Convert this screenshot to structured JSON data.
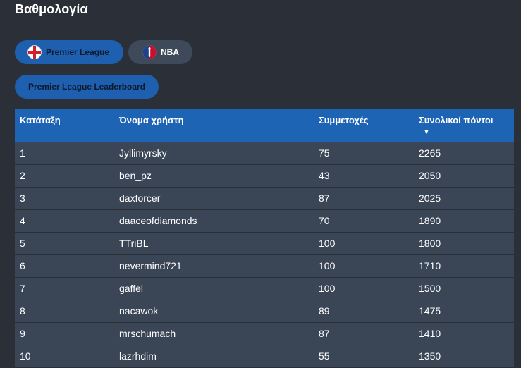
{
  "title": "Βαθμολογία",
  "tabs": [
    {
      "label": "Premier League",
      "icon": "england-flag-icon",
      "active": true
    },
    {
      "label": "NBA",
      "icon": "nba-logo-icon",
      "active": false
    }
  ],
  "leaderboard_button": "Premier League Leaderboard",
  "table": {
    "headers": [
      "Κατάταξη",
      "Όνομα χρήστη",
      "Συμμετοχές",
      "Συνολικοί πόντοι"
    ],
    "sort_indicator": "▼",
    "rows": [
      {
        "rank": "1",
        "user": "Jyllimyrsky",
        "entries": "75",
        "points": "2265"
      },
      {
        "rank": "2",
        "user": "ben_pz",
        "entries": "43",
        "points": "2050"
      },
      {
        "rank": "3",
        "user": "daxforcer",
        "entries": "87",
        "points": "2025"
      },
      {
        "rank": "4",
        "user": "daaceofdiamonds",
        "entries": "70",
        "points": "1890"
      },
      {
        "rank": "5",
        "user": "TTriBL",
        "entries": "100",
        "points": "1800"
      },
      {
        "rank": "6",
        "user": "nevermind721",
        "entries": "100",
        "points": "1710"
      },
      {
        "rank": "7",
        "user": "gaffel",
        "entries": "100",
        "points": "1500"
      },
      {
        "rank": "8",
        "user": "nacawok",
        "entries": "89",
        "points": "1475"
      },
      {
        "rank": "9",
        "user": "mrschumach",
        "entries": "87",
        "points": "1410"
      },
      {
        "rank": "10",
        "user": "lazrhdim",
        "entries": "55",
        "points": "1350"
      }
    ]
  },
  "colors": {
    "background": "#2b3038",
    "accent": "#1e5fb0",
    "header": "#1e64b4",
    "row": "#3a4556",
    "inactive_tab": "#3e4a5a"
  }
}
